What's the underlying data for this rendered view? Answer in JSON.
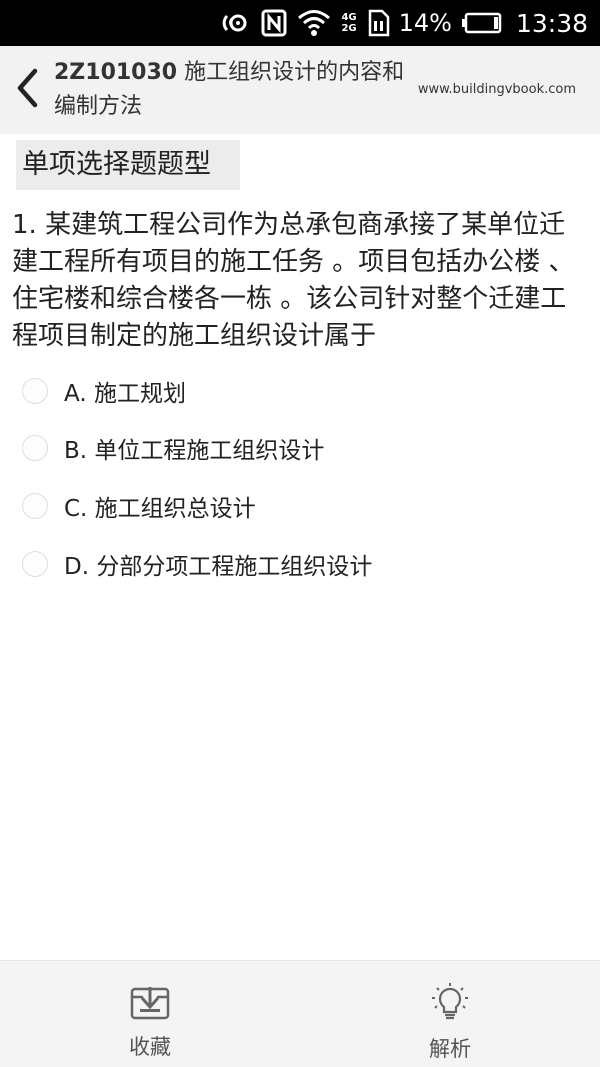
{
  "status_bar": {
    "network_left": "4G",
    "network_right": "2G",
    "battery": "14%",
    "time": "13:38"
  },
  "header": {
    "title_code": "2Z101030",
    "title_text": " 施工组织设计的内容和编制方法",
    "site": "www.buildingvbook.com",
    "back_icon": "chevron-left-icon"
  },
  "section": {
    "label": "单项选择题题型"
  },
  "question": {
    "text": "1. 某建筑工程公司作为总承包商承接了某单位迁建工程所有项目的施工任务 。项目包括办公楼 、住宅楼和综合楼各一栋 。该公司针对整个迁建工程项目制定的施工组织设计属于"
  },
  "options": [
    {
      "label": "A. 施工规划"
    },
    {
      "label": "B. 单位工程施工组织设计"
    },
    {
      "label": "C. 施工组织总设计"
    },
    {
      "label": "D. 分部分项工程施工组织设计"
    }
  ],
  "bottom_bar": {
    "favorite_label": "收藏",
    "analysis_label": "解析",
    "favorite_icon": "download-box-icon",
    "analysis_icon": "lightbulb-icon"
  },
  "colors": {
    "status_bg": "#000000",
    "header_bg": "#f2f2f2",
    "tag_bg": "#ececec",
    "bottom_bg": "#f4f4f4",
    "text": "#222222"
  }
}
